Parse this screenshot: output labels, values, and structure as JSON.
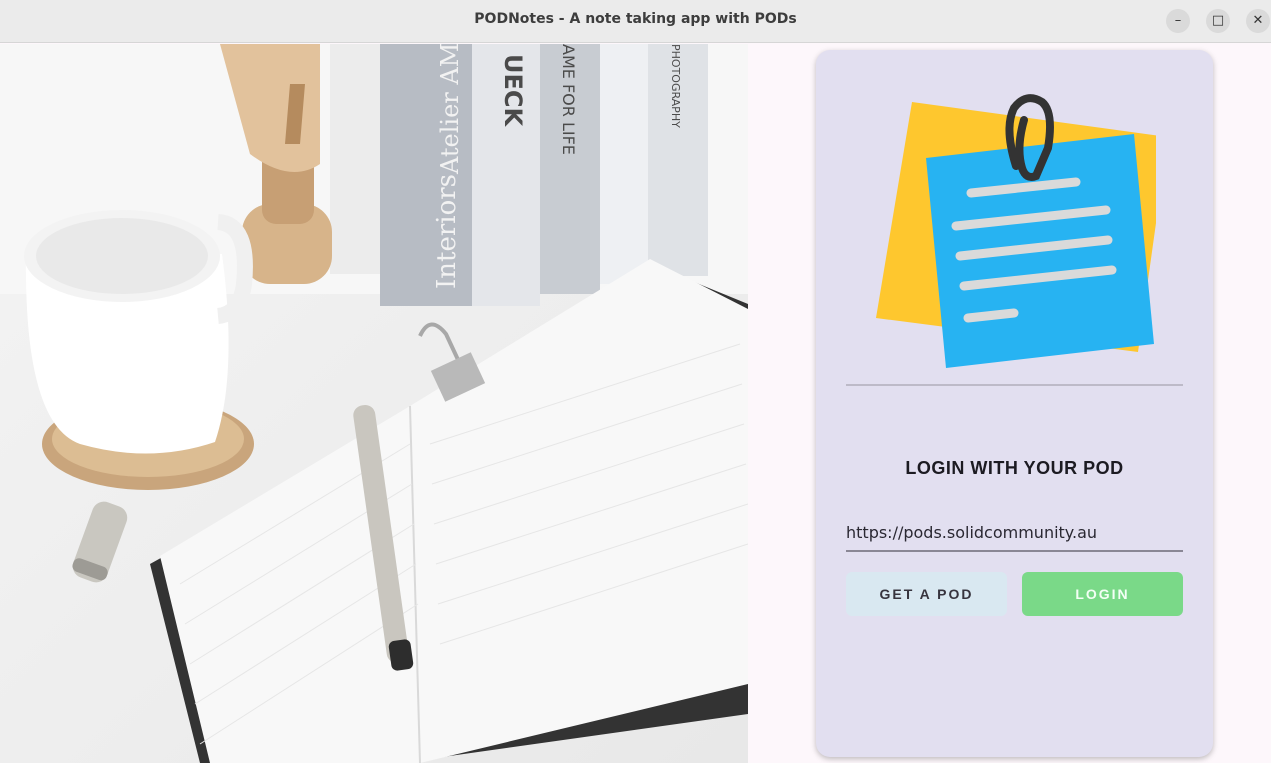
{
  "window": {
    "title": "PODNotes - A note taking app with PODs",
    "minimize_glyph": "–",
    "maximize_glyph": "□",
    "close_glyph": "✕"
  },
  "hero": {
    "icons": [
      "coffee-mug-icon",
      "wooden-hand-icon",
      "books-icon",
      "notebook-icon",
      "pen-icon",
      "binder-clip-icon"
    ],
    "book_spine_texts": [
      "Interiors",
      "Atelier AM",
      "UECK",
      "AME FOR LIFE",
      "PHOTOGRAPHY"
    ]
  },
  "login_card": {
    "logo_icon": "sticky-notes-icon",
    "heading": "LOGIN WITH YOUR POD",
    "pod_url_value": "https://pods.solidcommunity.au",
    "get_pod_label": "GET A POD",
    "login_label": "LOGIN"
  },
  "colors": {
    "card_bg": "#e2dff0",
    "login_green": "#7ad988",
    "get_pod_bg": "#d9e8f1",
    "note_blue": "#27b3f2",
    "note_yellow": "#fec72e"
  }
}
